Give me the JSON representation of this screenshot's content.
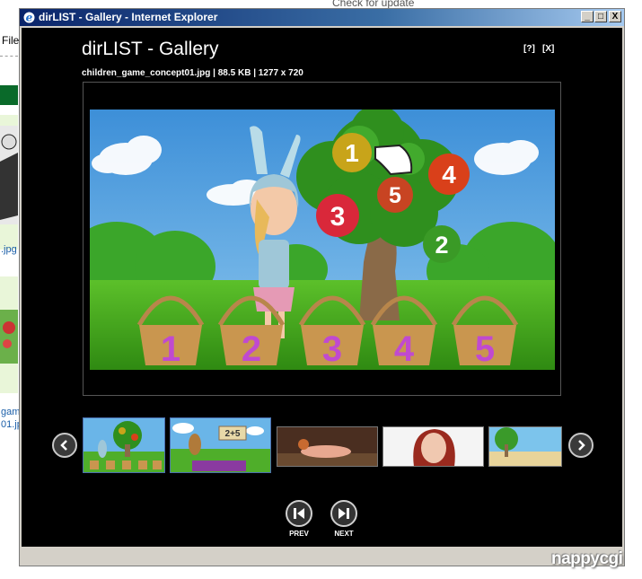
{
  "background_page": {
    "top_link": "Check for update",
    "menu_file": "File",
    "side_texts": [
      ".jpg",
      "gam",
      "01.jp"
    ]
  },
  "window": {
    "title": "dirLIST - Gallery - Internet Explorer",
    "min_label": "_",
    "max_label": "□",
    "close_label": "X"
  },
  "gallery": {
    "title": "dirLIST - Gallery",
    "help_label": "[?]",
    "close_label": "[X]",
    "file_info": "children_game_concept01.jpg | 88.5 KB | 1277 x 720",
    "numbers": [
      "1",
      "5",
      "4",
      "3",
      "2"
    ],
    "basket_numbers": [
      "1",
      "2",
      "3",
      "4",
      "5"
    ],
    "thumb2_sign": "2+5",
    "prev_label": "PREV",
    "next_label": "NEXT"
  },
  "watermark": "nappycgi"
}
